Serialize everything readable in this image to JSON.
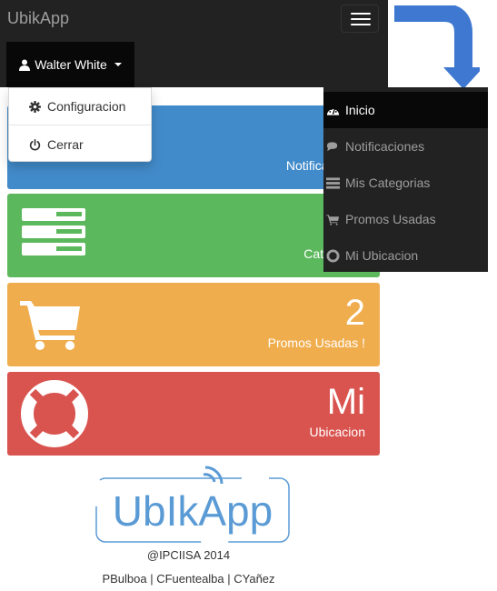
{
  "navbar": {
    "brand": "UbikApp",
    "user_name": "Walter White"
  },
  "dropdown": {
    "items": [
      {
        "label": "Configuracion",
        "icon": "gear-icon"
      },
      {
        "label": "Cerrar",
        "icon": "power-icon"
      }
    ]
  },
  "tiles": [
    {
      "value": "",
      "label": "Notificaciones",
      "icon": "comments-icon",
      "color": "#428bca"
    },
    {
      "value": "",
      "label": "Categorias",
      "icon": "list-icon",
      "color": "#5cb85c"
    },
    {
      "value": "2",
      "label": "Promos Usadas !",
      "icon": "shopping-cart-icon",
      "color": "#f0ad4e"
    },
    {
      "value": "Mi",
      "label": "Ubicacion",
      "icon": "life-ring-icon",
      "color": "#d9534f"
    }
  ],
  "side_menu": {
    "items": [
      {
        "label": "Inicio",
        "icon": "dashboard-icon",
        "active": true
      },
      {
        "label": "Notificaciones",
        "icon": "comments-icon",
        "active": false
      },
      {
        "label": "Mis Categorias",
        "icon": "list-icon",
        "active": false
      },
      {
        "label": "Promos Usadas",
        "icon": "shopping-cart-icon",
        "active": false
      },
      {
        "label": "Mi Ubicacion",
        "icon": "life-ring-icon",
        "active": false
      }
    ]
  },
  "footer": {
    "logo_text": "UbIkApp",
    "copyright": "@IPCIISA 2014",
    "authors": "PBulboa | CFuentealba | CYañez"
  },
  "colors": {
    "navbar": "#222222",
    "active": "#080808",
    "arrow": "#3f78d0"
  }
}
